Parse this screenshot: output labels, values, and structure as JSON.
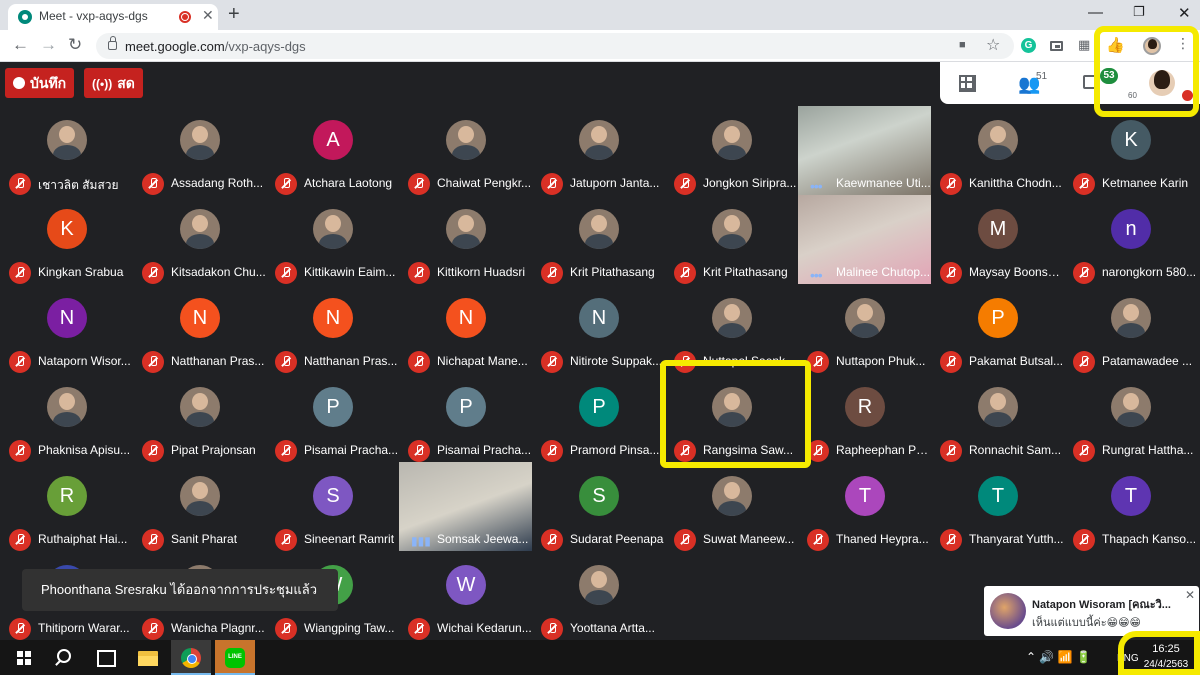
{
  "browser": {
    "tab_title": "Meet - vxp-aqys-dgs",
    "tab_close": "✕",
    "new_tab": "+",
    "window_min": "—",
    "window_restore": "❐",
    "window_close": "✕",
    "url_host": "meet.google.com",
    "url_path": "/vxp-aqys-dgs",
    "back": "←",
    "forward": "→",
    "reload": "↻",
    "camera_icon": "■",
    "star_icon": "☆",
    "grammarly": "G",
    "grid_ext": "▦",
    "like_ext": "👍",
    "menu": "⋮"
  },
  "meet": {
    "record_label": "บันทึก",
    "live_label": "สด",
    "live_icon": "((•))",
    "people_icon": "👥",
    "people_count": "51",
    "chat_badge": "53",
    "chat_count": "60"
  },
  "participants": [
    {
      "name": "เชาวลิต สัมสวย",
      "initial": "",
      "color": "",
      "kind": "photo"
    },
    {
      "name": "Assadang Roth...",
      "initial": "",
      "color": "",
      "kind": "photo"
    },
    {
      "name": "Atchara Laotong",
      "initial": "A",
      "color": "#c2185b",
      "kind": "letter"
    },
    {
      "name": "Chaiwat Pengkr...",
      "initial": "",
      "color": "",
      "kind": "photo"
    },
    {
      "name": "Jatuporn Janta...",
      "initial": "",
      "color": "",
      "kind": "photo"
    },
    {
      "name": "Jongkon Siripra...",
      "initial": "",
      "color": "",
      "kind": "photo"
    },
    {
      "name": "Kaewmanee Uti...",
      "initial": "",
      "color": "",
      "kind": "video"
    },
    {
      "name": "Kanittha Chodn...",
      "initial": "",
      "color": "",
      "kind": "photo"
    },
    {
      "name": "Ketmanee Karin",
      "initial": "K",
      "color": "#455a64",
      "kind": "letter"
    },
    {
      "name": "Kingkan Srabua",
      "initial": "K",
      "color": "#e64a19",
      "kind": "letter"
    },
    {
      "name": "Kitsadakon Chu...",
      "initial": "",
      "color": "",
      "kind": "photo"
    },
    {
      "name": "Kittikawin Eaim...",
      "initial": "",
      "color": "",
      "kind": "photo"
    },
    {
      "name": "Kittikorn Huadsri",
      "initial": "",
      "color": "",
      "kind": "photo"
    },
    {
      "name": "Krit Pitathasang",
      "initial": "",
      "color": "",
      "kind": "photo"
    },
    {
      "name": "Krit Pitathasang",
      "initial": "",
      "color": "",
      "kind": "photo"
    },
    {
      "name": "Malinee Chutop...",
      "initial": "",
      "color": "",
      "kind": "video2"
    },
    {
      "name": "Maysay Boonse...",
      "initial": "M",
      "color": "#6d4c41",
      "kind": "letter"
    },
    {
      "name": "narongkorn 580...",
      "initial": "n",
      "color": "#512da8",
      "kind": "letter"
    },
    {
      "name": "Nataporn Wisor...",
      "initial": "N",
      "color": "#7b1fa2",
      "kind": "letter"
    },
    {
      "name": "Natthanan Pras...",
      "initial": "N",
      "color": "#f4511e",
      "kind": "letter"
    },
    {
      "name": "Natthanan Pras...",
      "initial": "N",
      "color": "#f4511e",
      "kind": "letter"
    },
    {
      "name": "Nichapat Mane...",
      "initial": "N",
      "color": "#f4511e",
      "kind": "letter"
    },
    {
      "name": "Nitirote Suppak...",
      "initial": "N",
      "color": "#546e7a",
      "kind": "letter"
    },
    {
      "name": "Nuttapol Saenk...",
      "initial": "",
      "color": "",
      "kind": "photo"
    },
    {
      "name": "Nuttapon Phuk...",
      "initial": "",
      "color": "",
      "kind": "photo"
    },
    {
      "name": "Pakamat Butsal...",
      "initial": "P",
      "color": "#f57c00",
      "kind": "letter"
    },
    {
      "name": "Patamawadee ...",
      "initial": "",
      "color": "",
      "kind": "photo"
    },
    {
      "name": "Phaknisa Apisu...",
      "initial": "",
      "color": "",
      "kind": "photo"
    },
    {
      "name": "Pipat Prajonsan",
      "initial": "",
      "color": "",
      "kind": "photo"
    },
    {
      "name": "Pisamai Pracha...",
      "initial": "P",
      "color": "#607d8b",
      "kind": "letter"
    },
    {
      "name": "Pisamai Pracha...",
      "initial": "P",
      "color": "#607d8b",
      "kind": "letter"
    },
    {
      "name": "Pramord Pinsa...",
      "initial": "P",
      "color": "#00897b",
      "kind": "letter"
    },
    {
      "name": "Rangsima Saw...",
      "initial": "",
      "color": "",
      "kind": "photo"
    },
    {
      "name": "Rapheephan Ph...",
      "initial": "R",
      "color": "#6d4c41",
      "kind": "letter"
    },
    {
      "name": "Ronnachit Sam...",
      "initial": "",
      "color": "",
      "kind": "photo"
    },
    {
      "name": "Rungrat Hattha...",
      "initial": "",
      "color": "",
      "kind": "photo"
    },
    {
      "name": "Ruthaiphat Hai...",
      "initial": "R",
      "color": "#689f38",
      "kind": "letter"
    },
    {
      "name": "Sanit Pharat",
      "initial": "",
      "color": "",
      "kind": "photo"
    },
    {
      "name": "Sineenart Ramrit",
      "initial": "S",
      "color": "#7e57c2",
      "kind": "letter"
    },
    {
      "name": "Somsak Jeewa...",
      "initial": "",
      "color": "",
      "kind": "video3"
    },
    {
      "name": "Sudarat Peenapa",
      "initial": "S",
      "color": "#388e3c",
      "kind": "letter"
    },
    {
      "name": "Suwat Maneew...",
      "initial": "",
      "color": "",
      "kind": "photo"
    },
    {
      "name": "Thaned Heypra...",
      "initial": "T",
      "color": "#ab47bc",
      "kind": "letter"
    },
    {
      "name": "Thanyarat Yutth...",
      "initial": "T",
      "color": "#00897b",
      "kind": "letter"
    },
    {
      "name": "Thapach Kanso...",
      "initial": "T",
      "color": "#5e35b1",
      "kind": "letter"
    },
    {
      "name": "Thitiporn Warar...",
      "initial": "",
      "color": "#3949ab",
      "kind": "letter"
    },
    {
      "name": "Wanicha Plagnr...",
      "initial": "",
      "color": "",
      "kind": "photo"
    },
    {
      "name": "Wiangping Taw...",
      "initial": "W",
      "color": "#43a047",
      "kind": "letter"
    },
    {
      "name": "Wichai Kedarun...",
      "initial": "W",
      "color": "#7e57c2",
      "kind": "letter"
    },
    {
      "name": "Yoottana Artta...",
      "initial": "",
      "color": "",
      "kind": "photo"
    }
  ],
  "snackbar": "Phoonthana Sresraku ได้ออกจากการประชุมแล้ว",
  "notification": {
    "sender": "Natapon  Wisoram [คณะวิ...",
    "message": "เห็นแต่แบบนี้ค่ะ😁😁😁",
    "close": "✕"
  },
  "taskbar": {
    "line_label": "LINE",
    "tray_icons": "⌃  🔊  📶  🔋",
    "language": "ENG",
    "time": "16:25",
    "date": "24/4/2563"
  },
  "colors": {
    "highlight": "#f5ea00",
    "record_red": "#c5221f",
    "mute_red": "#d93025"
  }
}
